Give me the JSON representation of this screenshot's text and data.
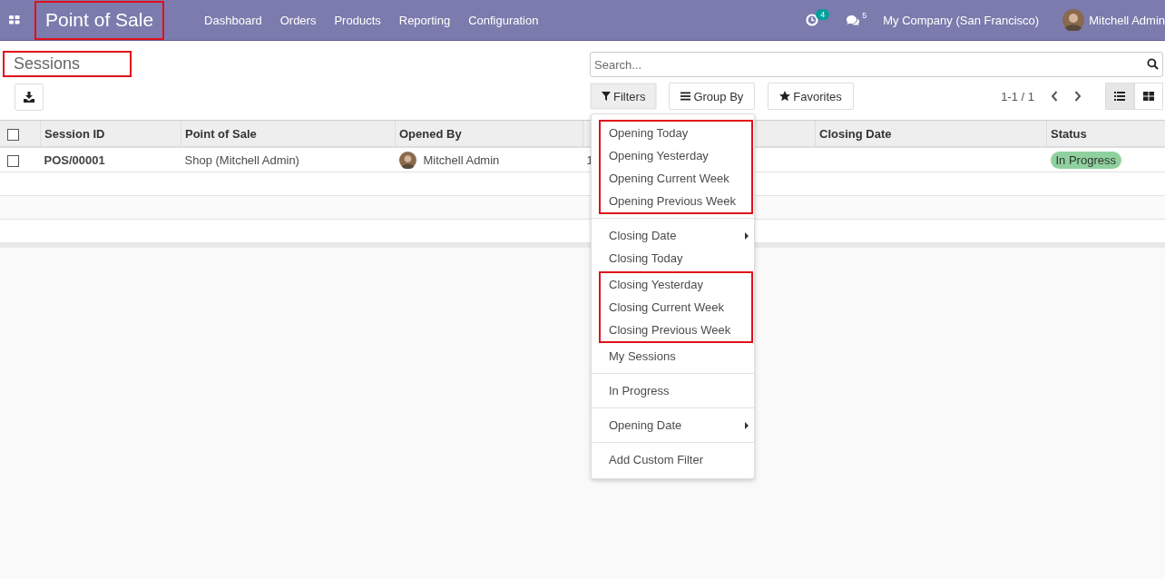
{
  "navbar": {
    "app_title": {
      "text": "Point of Sale",
      "highlighted": true
    },
    "menu": [
      "Dashboard",
      "Orders",
      "Products",
      "Reporting",
      "Configuration"
    ],
    "activity_count": "4",
    "message_count": "5",
    "company": "My Company (San Francisco)",
    "user": "Mitchell Admin"
  },
  "breadcrumb": {
    "text": "Sessions",
    "highlighted": true
  },
  "search": {
    "placeholder": "Search..."
  },
  "search_buttons": [
    {
      "label": "Filters",
      "kind": "filter",
      "selected": true
    },
    {
      "label": "Group By",
      "kind": "group",
      "selected": false
    },
    {
      "label": "Favorites",
      "kind": "star",
      "selected": false
    }
  ],
  "pager": "1-1 / 1",
  "views": [
    {
      "kind": "list",
      "selected": true
    },
    {
      "kind": "kanban",
      "selected": false
    }
  ],
  "table": {
    "all_checked": false,
    "columns": [
      {
        "label": "Session ID"
      },
      {
        "label": "Point of Sale"
      },
      {
        "label": "Opened By"
      },
      {},
      {
        "label": "Closing Date"
      },
      {
        "label": "Status"
      }
    ],
    "rows": [
      {
        "checked": false,
        "session_id": "POS/00001",
        "point_of_sale": "Shop (Mitchell Admin)",
        "opened_by": "Mitchell Admin",
        "column_4": "1",
        "closing_date": "",
        "status": "In Progress"
      }
    ]
  },
  "filters_menu": [
    {
      "blocks": [
        {
          "highlighted": true,
          "items": [
            {
              "label": "Opening Today",
              "kind": "option"
            },
            {
              "label": "Opening Yesterday",
              "kind": "option"
            },
            {
              "label": "Opening Current Week",
              "kind": "option"
            },
            {
              "label": "Opening Previous Week",
              "kind": "option"
            }
          ]
        }
      ]
    },
    {
      "blocks": [
        {
          "highlighted": false,
          "items": [
            {
              "label": "Closing Date",
              "kind": "submenu"
            },
            {
              "label": "Closing Today",
              "kind": "option"
            }
          ]
        },
        {
          "highlighted": true,
          "items": [
            {
              "label": "Closing Yesterday",
              "kind": "option"
            },
            {
              "label": "Closing Current Week",
              "kind": "option"
            },
            {
              "label": "Closing Previous Week",
              "kind": "option"
            }
          ]
        },
        {
          "highlighted": false,
          "items": [
            {
              "label": "My Sessions",
              "kind": "option"
            }
          ]
        }
      ]
    },
    {
      "blocks": [
        {
          "highlighted": false,
          "items": [
            {
              "label": "In Progress",
              "kind": "option"
            }
          ]
        }
      ]
    },
    {
      "blocks": [
        {
          "highlighted": false,
          "items": [
            {
              "label": "Opening Date",
              "kind": "submenu"
            }
          ]
        }
      ]
    },
    {
      "blocks": [
        {
          "highlighted": false,
          "items": [
            {
              "label": "Add Custom Filter",
              "kind": "option"
            }
          ]
        }
      ]
    }
  ]
}
